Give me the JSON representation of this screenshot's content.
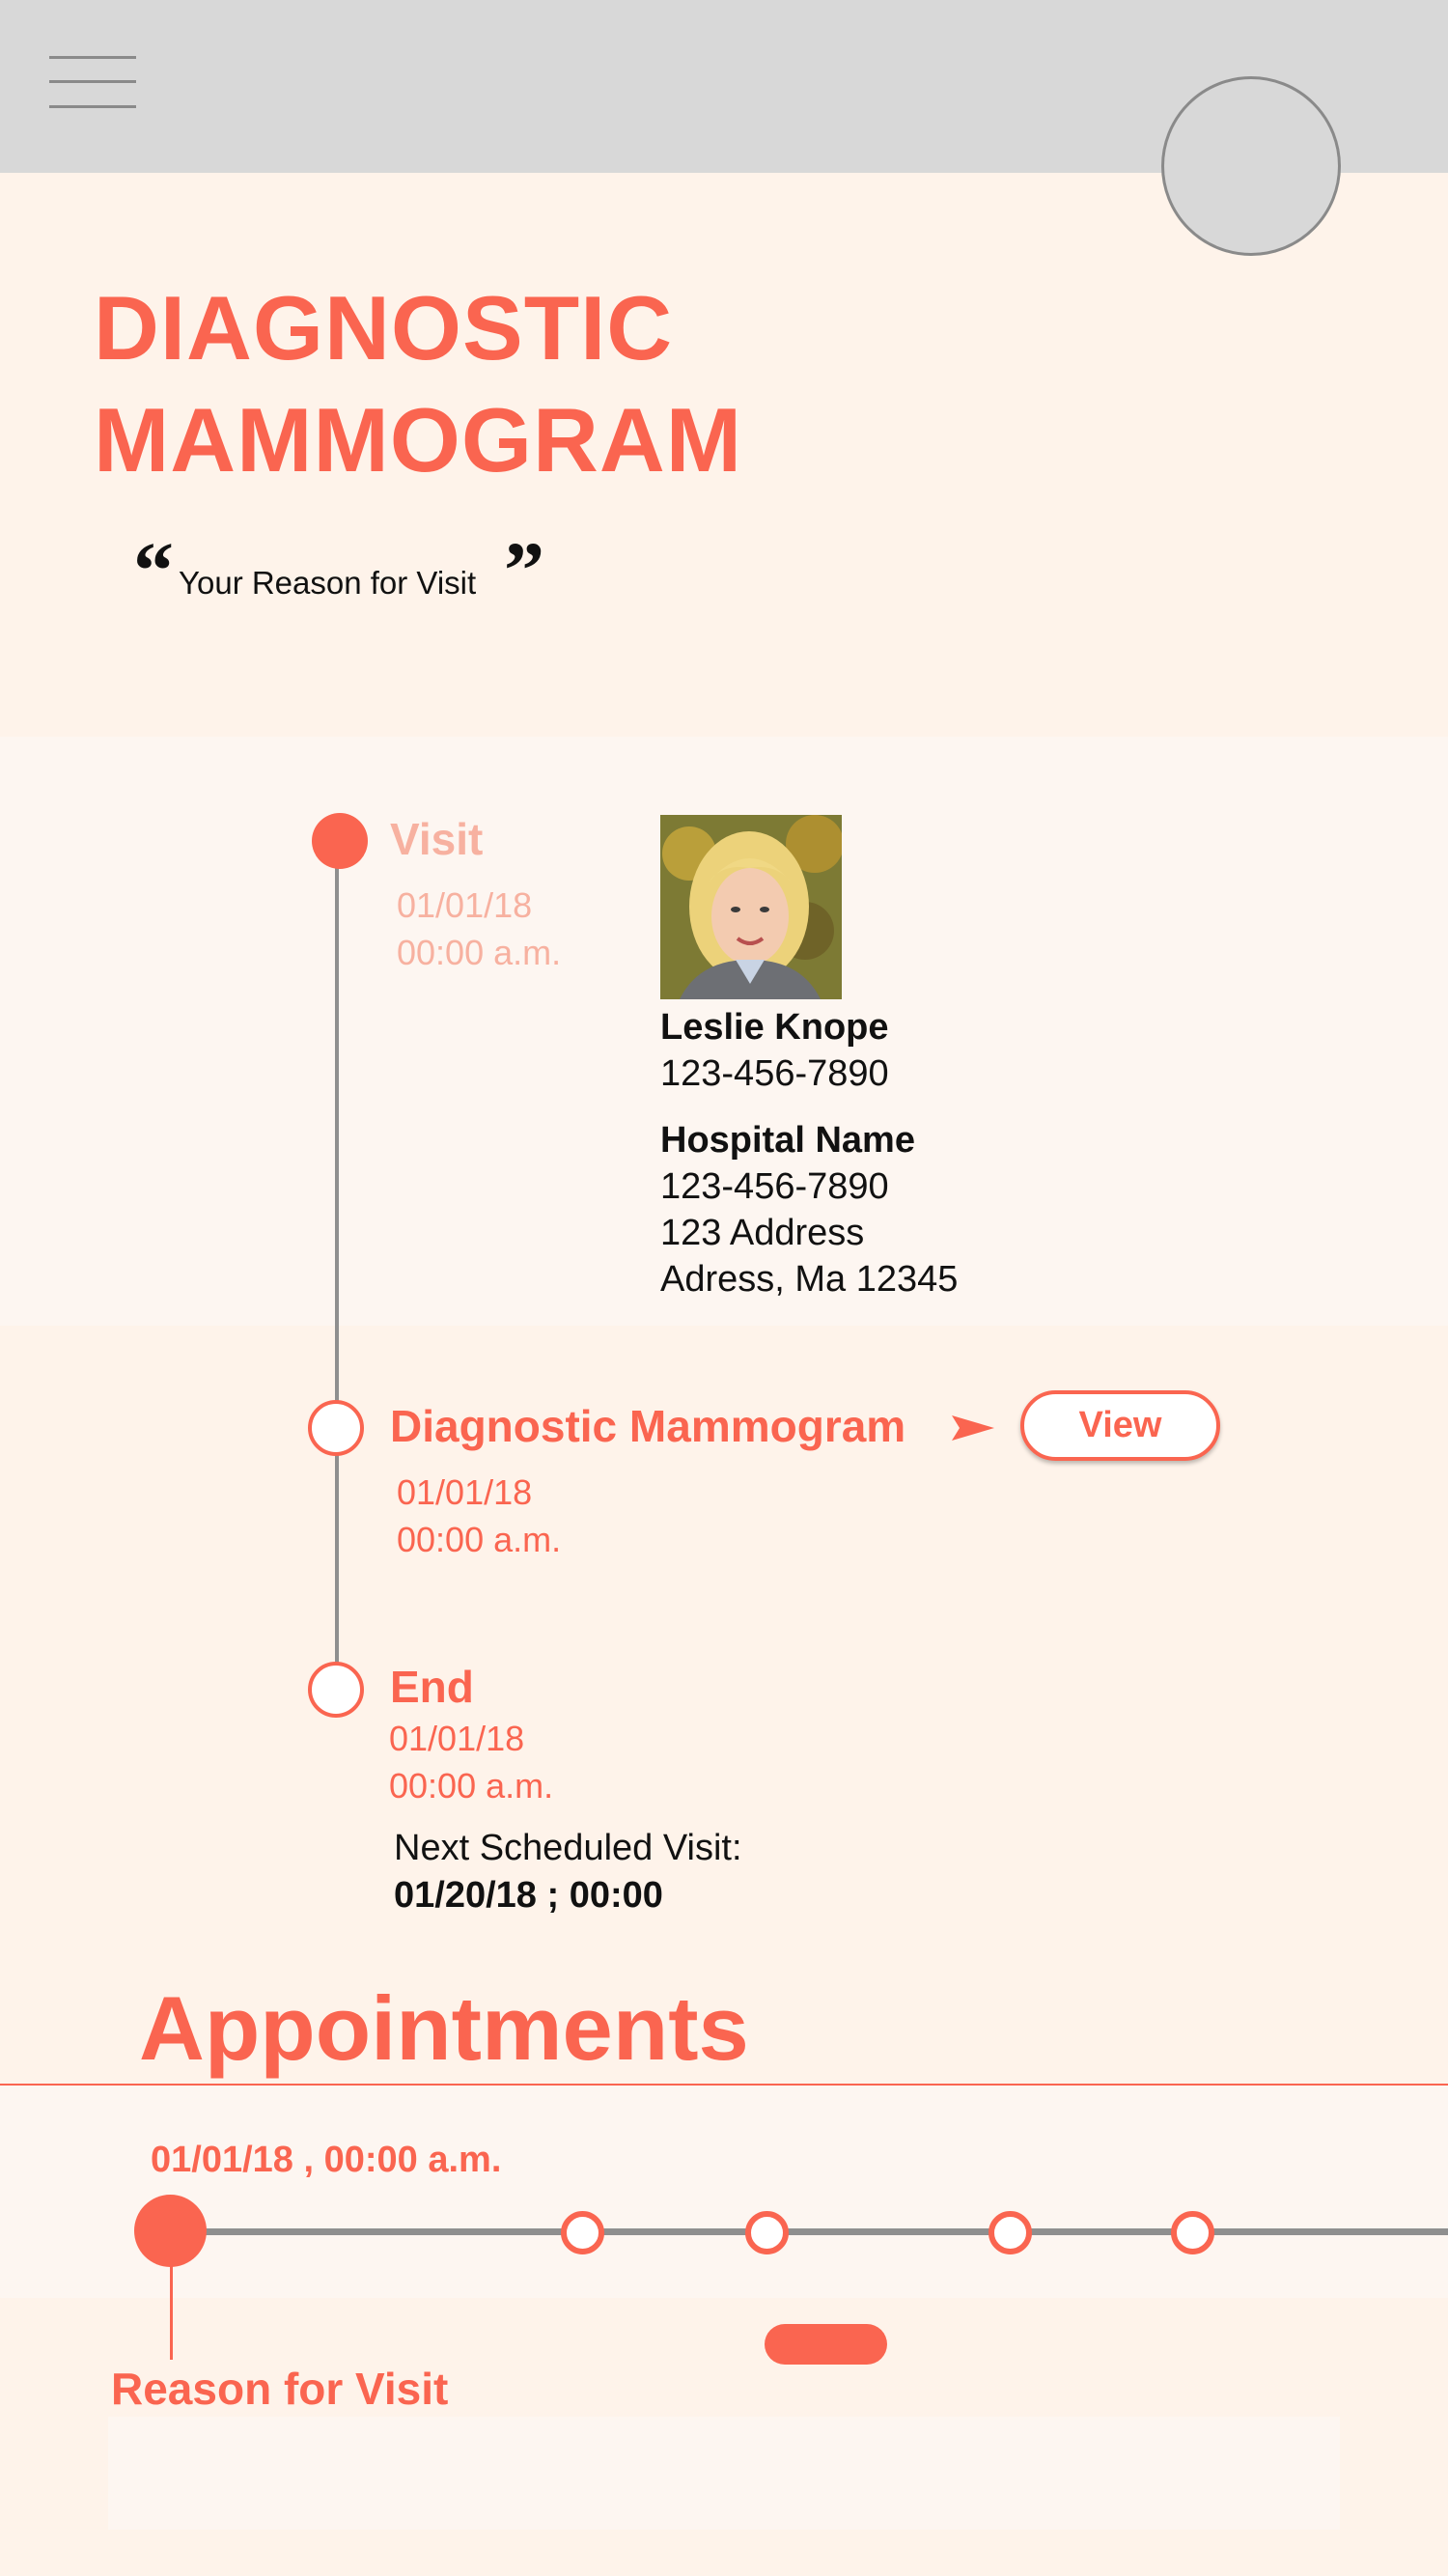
{
  "header": {
    "title_line1": "DIAGNOSTIC",
    "title_line2": "MAMMOGRAM",
    "reason_for_visit": "Your Reason for Visit"
  },
  "timeline": {
    "visit": {
      "title": "Visit",
      "date": "01/01/18",
      "time": "00:00 a.m."
    },
    "doctor": {
      "name": "Leslie Knope",
      "phone": "123-456-7890"
    },
    "hospital": {
      "name": "Hospital Name",
      "phone": "123-456-7890",
      "address1": "123 Address",
      "address2": "Adress, Ma 12345"
    },
    "procedure": {
      "title": "Diagnostic Mammogram",
      "date": "01/01/18",
      "time": "00:00 a.m.",
      "button_label": "View"
    },
    "end": {
      "title": "End",
      "date": "01/01/18",
      "time": "00:00 a.m."
    },
    "next_visit": {
      "label": "Next Scheduled Visit:",
      "value": "01/20/18 ; 00:00"
    }
  },
  "appointments": {
    "title": "Appointments",
    "selected_date": "01/01/18 , 00:00 a.m.",
    "reason_label": "Reason for Visit"
  },
  "colors": {
    "accent": "#fa6550",
    "accent_faded": "#f7b1a0",
    "background": "#fef3ea",
    "band": "#fdf6f1",
    "topbar": "#d8d8d8",
    "line": "#8f8f8f"
  }
}
